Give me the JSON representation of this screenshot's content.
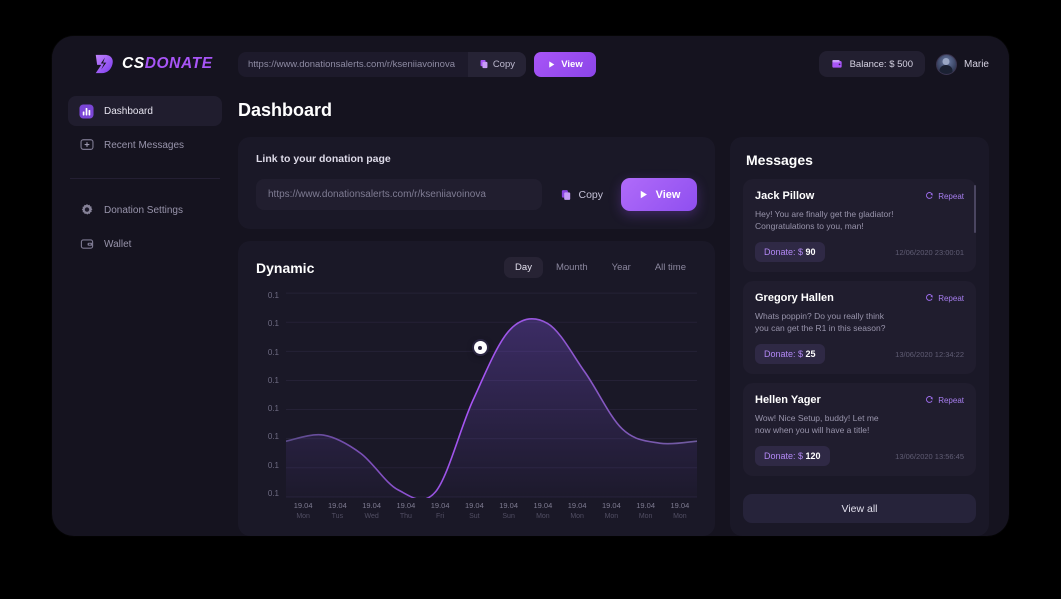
{
  "brand": {
    "cs": "CS",
    "donate": "DONATE",
    "mark_icon": "lightning-d-logo-icon"
  },
  "topbar": {
    "url_value": "https://www.donationsalerts.com/r/kseniiavoinova",
    "copy_label": "Copy",
    "copy_icon": "copy-icon",
    "view_label": "View",
    "view_icon": "play-icon",
    "balance_label": "Balance: $ 500",
    "balance_icon": "wallet-icon",
    "user_name": "Marie",
    "avatar_icon": "user-avatar"
  },
  "sidebar": {
    "items": [
      {
        "label": "Dashboard",
        "icon": "bar-chart-icon",
        "active": true
      },
      {
        "label": "Recent Messages",
        "icon": "message-plus-icon",
        "active": false
      },
      {
        "label": "Donation Settings",
        "icon": "gear-icon",
        "active": false
      },
      {
        "label": "Wallet",
        "icon": "wallet-icon",
        "active": false
      }
    ]
  },
  "page": {
    "title": "Dashboard"
  },
  "link_card": {
    "label": "Link to your donation page",
    "url_value": "https://www.donationsalerts.com/r/kseniiavoinova",
    "url_placeholder": "https://www.donationsalerts.com/r/kseniiavoinova",
    "copy_label": "Copy",
    "copy_icon": "copy-icon",
    "view_label": "View",
    "view_icon": "play-icon"
  },
  "chart_card": {
    "title": "Dynamic",
    "tabs": [
      {
        "label": "Day",
        "active": true
      },
      {
        "label": "Mounth",
        "active": false
      },
      {
        "label": "Year",
        "active": false
      },
      {
        "label": "All time",
        "active": false
      }
    ]
  },
  "chart_data": {
    "type": "area",
    "title": "Dynamic",
    "xlabel": "",
    "ylabel": "",
    "grid": true,
    "legend": false,
    "line_color": "#a855f7",
    "categories": [
      "19.04",
      "19.04",
      "19.04",
      "19.04",
      "19.04",
      "19.04",
      "19.04",
      "19.04",
      "19.04",
      "19.04",
      "19.04",
      "19.04"
    ],
    "sublabels": [
      "Mon",
      "Tus",
      "Wed",
      "Thu",
      "Fri",
      "Sut",
      "Sun",
      "Mon",
      "Mon",
      "Mon",
      "Mon",
      "Mon"
    ],
    "ytick_labels": [
      "0.1",
      "0.1",
      "0.1",
      "0.1",
      "0.1",
      "0.1",
      "0.1",
      "0.1"
    ],
    "ylim": [
      0,
      0.1
    ],
    "values": [
      0.028,
      0.031,
      0.022,
      0.004,
      0.003,
      0.048,
      0.083,
      0.086,
      0.062,
      0.034,
      0.027,
      0.028
    ],
    "highlight_point": {
      "index_x": 5.2,
      "value": 0.074,
      "label": ""
    }
  },
  "messages": {
    "title": "Messages",
    "repeat_label": "Repeat",
    "repeat_icon": "refresh-icon",
    "view_all_label": "View all",
    "items": [
      {
        "name": "Jack Pillow",
        "text": "Hey! You are finally get the gladiator!\nCongratulations to you, man!",
        "donate_label": "Donate: $",
        "donate_amount": "90",
        "timestamp": "12/06/2020  23:00:01"
      },
      {
        "name": "Gregory Hallen",
        "text": "Whats poppin? Do you really think\nyou can get the R1 in this season?",
        "donate_label": "Donate: $",
        "donate_amount": "25",
        "timestamp": "13/06/2020  12:34:22"
      },
      {
        "name": "Hellen Yager",
        "text": "Wow! Nice Setup, buddy! Let me\nnow when you will have a title!",
        "donate_label": "Donate: $",
        "donate_amount": "120",
        "timestamp": "13/06/2020  13:56:45"
      }
    ]
  },
  "colors": {
    "accent": "#a855f7",
    "window_bg": "#15131f",
    "card_bg": "#1a1827",
    "panel_bg": "#201d2e",
    "page_bg": "#000000"
  }
}
